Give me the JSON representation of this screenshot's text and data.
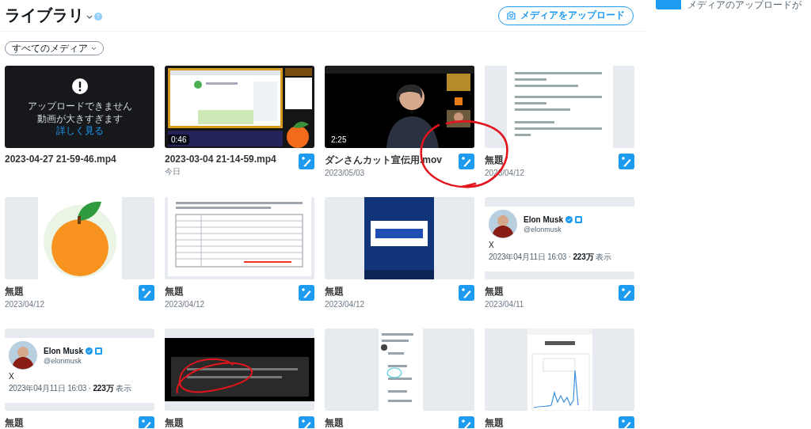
{
  "header": {
    "title": "ライブラリ",
    "upload_button": "メディアをアップロード"
  },
  "toast": {
    "text": "メディアのアップロードが"
  },
  "filter": {
    "label": "すべてのメディア"
  },
  "media": [
    {
      "kind": "error",
      "message": [
        "アップロードできません",
        "動画が大きすぎます"
      ],
      "link": "詳しく見る",
      "caption": "2023-04-27 21-59-46.mp4",
      "editable": false
    },
    {
      "kind": "picture",
      "duration": "0:46",
      "caption": "2023-03-04 21-14-59.mp4",
      "date": "今日",
      "editable": true
    },
    {
      "kind": "picture",
      "duration": "2:25",
      "caption": "ダンさんカット宣伝用.mov",
      "date": "2023/05/03",
      "editable": true
    },
    {
      "kind": "picture",
      "caption": "無題",
      "date": "2023/04/12",
      "editable": true
    },
    {
      "kind": "picture",
      "caption": "無題",
      "date": "2023/04/12",
      "editable": true
    },
    {
      "kind": "picture",
      "caption": "無題",
      "date": "2023/04/12",
      "editable": true
    },
    {
      "kind": "picture",
      "caption": "無題",
      "date": "2023/04/12",
      "editable": true
    },
    {
      "kind": "tweet",
      "name": "Elon Musk",
      "handle": "@elonmusk",
      "text": "X",
      "meta": "2023年04月11日 16:03 · **223万** 表示",
      "caption": "無題",
      "date": "2023/04/11",
      "editable": true
    },
    {
      "kind": "tweet",
      "name": "Elon Musk",
      "handle": "@elonmusk",
      "text": "X",
      "meta": "2023年04月11日 16:03 · **223万** 表示",
      "caption": "無題",
      "editable": true
    },
    {
      "kind": "picture",
      "caption": "無題",
      "editable": true
    },
    {
      "kind": "picture",
      "caption": "無題",
      "editable": true
    },
    {
      "kind": "picture",
      "caption": "無題",
      "editable": true
    }
  ]
}
